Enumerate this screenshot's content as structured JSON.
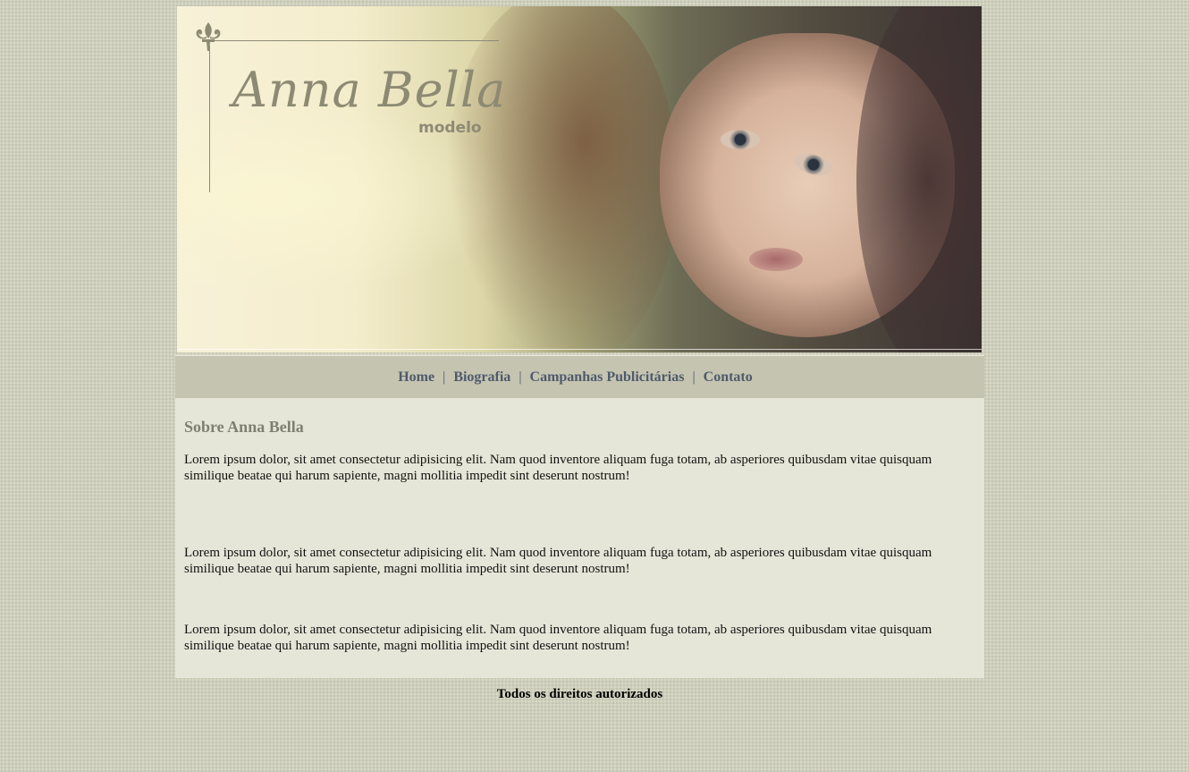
{
  "banner": {
    "logo_title": "Anna Bella",
    "logo_subtitle": "modelo",
    "photo_icon": "woman-portrait-image",
    "fleur_icon": "fleur-de-lis-icon"
  },
  "nav": {
    "items": [
      {
        "label": "Home"
      },
      {
        "label": "Biografia"
      },
      {
        "label": "Campanhas Publicitárias"
      },
      {
        "label": "Contato"
      }
    ],
    "separator": "|"
  },
  "content": {
    "heading": "Sobre Anna Bella",
    "paragraphs": [
      "Lorem ipsum dolor, sit amet consectetur adipisicing elit. Nam quod inventore aliquam fuga totam, ab asperiores quibusdam vitae quisquam similique beatae qui harum sapiente, magni mollitia impedit sint deserunt nostrum!",
      "Lorem ipsum dolor, sit amet consectetur adipisicing elit. Nam quod inventore aliquam fuga totam, ab asperiores quibusdam vitae quisquam similique beatae qui harum sapiente, magni mollitia impedit sint deserunt nostrum!",
      "Lorem ipsum dolor, sit amet consectetur adipisicing elit. Nam quod inventore aliquam fuga totam, ab asperiores quibusdam vitae quisquam similique beatae qui harum sapiente, magni mollitia impedit sint deserunt nostrum!"
    ]
  },
  "footer": {
    "text": "Todos os direitos autorizados"
  },
  "colors": {
    "page_background": "#cfcfbd",
    "nav_background": "#c5c4b0",
    "nav_link": "#4f5a6c",
    "content_background": "#e6e6d8",
    "heading": "#7f7e72",
    "logo": "#8d8a74"
  }
}
